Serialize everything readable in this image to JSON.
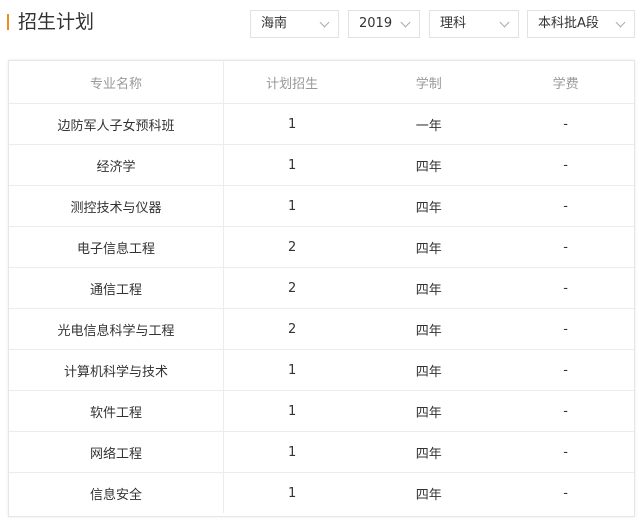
{
  "header": {
    "title": "招生计划"
  },
  "filters": {
    "province": "海南",
    "year": "2019",
    "subject": "理科",
    "batch": "本科批A段"
  },
  "colors": {
    "accent": "#f08a24",
    "header_text": "#999999",
    "body_text": "#333333",
    "border": "#ececec"
  },
  "table": {
    "columns": [
      "专业名称",
      "计划招生",
      "学制",
      "学费"
    ],
    "rows": [
      {
        "major": "边防军人子女预科班",
        "plan": "1",
        "duration": "一年",
        "fee": "-"
      },
      {
        "major": "经济学",
        "plan": "1",
        "duration": "四年",
        "fee": "-"
      },
      {
        "major": "测控技术与仪器",
        "plan": "1",
        "duration": "四年",
        "fee": "-"
      },
      {
        "major": "电子信息工程",
        "plan": "2",
        "duration": "四年",
        "fee": "-"
      },
      {
        "major": "通信工程",
        "plan": "2",
        "duration": "四年",
        "fee": "-"
      },
      {
        "major": "光电信息科学与工程",
        "plan": "2",
        "duration": "四年",
        "fee": "-"
      },
      {
        "major": "计算机科学与技术",
        "plan": "1",
        "duration": "四年",
        "fee": "-"
      },
      {
        "major": "软件工程",
        "plan": "1",
        "duration": "四年",
        "fee": "-"
      },
      {
        "major": "网络工程",
        "plan": "1",
        "duration": "四年",
        "fee": "-"
      },
      {
        "major": "信息安全",
        "plan": "1",
        "duration": "四年",
        "fee": "-"
      }
    ]
  }
}
